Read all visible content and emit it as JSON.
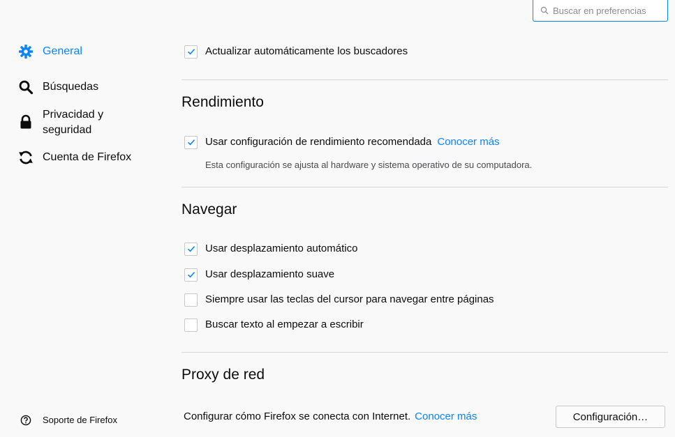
{
  "search": {
    "placeholder": "Buscar en preferencias",
    "icon": "search-icon"
  },
  "sidebar": {
    "items": [
      {
        "label": "General",
        "icon": "gear-icon",
        "selected": true
      },
      {
        "label": "Búsquedas",
        "icon": "search-icon",
        "selected": false
      },
      {
        "label": "Privacidad y seguridad",
        "icon": "lock-icon",
        "selected": false
      },
      {
        "label": "Cuenta de Firefox",
        "icon": "sync-icon",
        "selected": false
      }
    ],
    "support": {
      "label": "Soporte de Firefox",
      "icon": "help-icon"
    }
  },
  "main": {
    "update_engines": {
      "label": "Actualizar automáticamente los buscadores",
      "checked": true
    },
    "performance": {
      "heading": "Rendimiento",
      "recommended": {
        "label": "Usar configuración de rendimiento recomendada",
        "checked": true
      },
      "learn_more": "Conocer más",
      "description": "Esta configuración se ajusta al hardware y sistema operativo de su computadora."
    },
    "browsing": {
      "heading": "Navegar",
      "options": [
        {
          "label": "Usar desplazamiento automático",
          "checked": true
        },
        {
          "label": "Usar desplazamiento suave",
          "checked": true
        },
        {
          "label": "Siempre usar las teclas del cursor para navegar entre páginas",
          "checked": false
        },
        {
          "label": "Buscar texto al empezar a escribir",
          "checked": false
        }
      ]
    },
    "proxy": {
      "heading": "Proxy de red",
      "text": "Configurar cómo Firefox se conecta con Internet.",
      "learn_more": "Conocer más",
      "button": "Configuración…"
    }
  },
  "colors": {
    "accent": "#0a84ff",
    "background": "#f9f9fa",
    "text": "#0c0c0d",
    "divider": "#d7d7db"
  }
}
